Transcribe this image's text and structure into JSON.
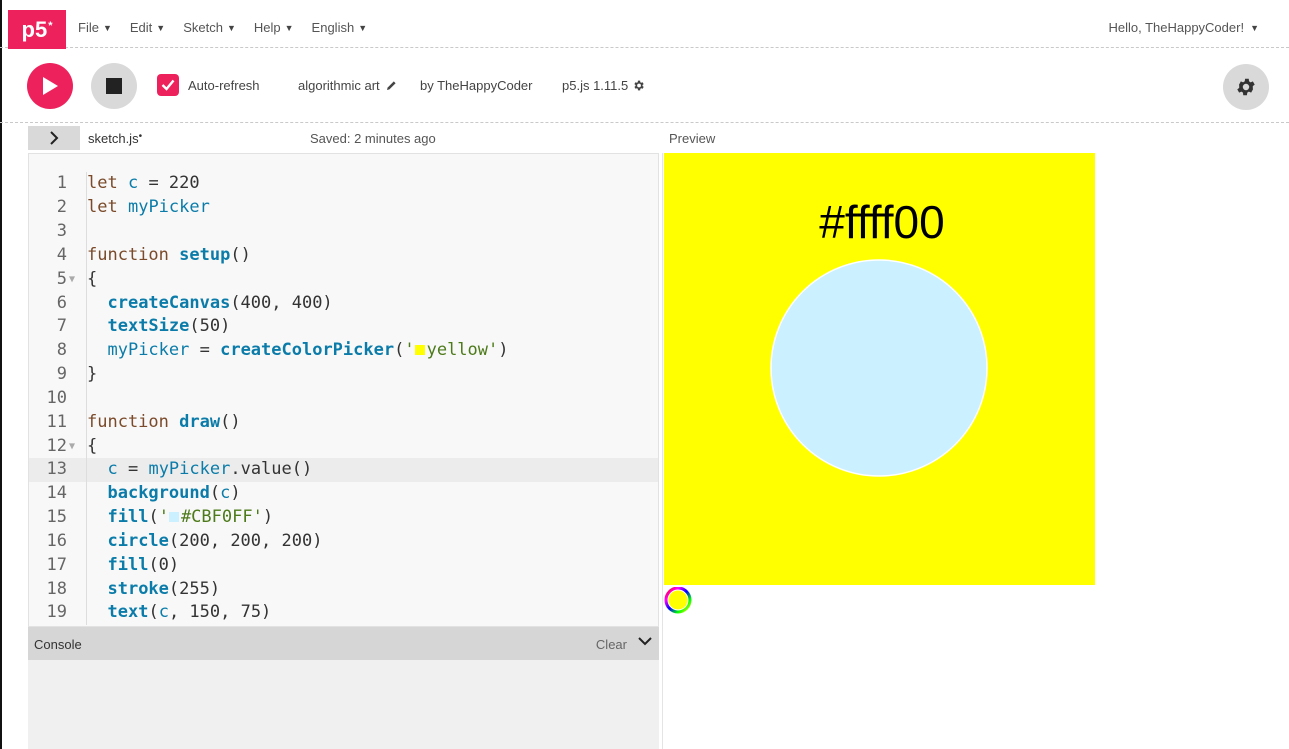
{
  "nav": {
    "logo": "p5",
    "logo_sup": "*",
    "menu": [
      {
        "label": "File"
      },
      {
        "label": "Edit"
      },
      {
        "label": "Sketch"
      },
      {
        "label": "Help"
      },
      {
        "label": "English"
      }
    ],
    "user_greeting": "Hello, TheHappyCoder!"
  },
  "toolbar": {
    "auto_refresh_label": "Auto-refresh",
    "auto_refresh_checked": true,
    "sketch_name": "algorithmic art",
    "owner": "by TheHappyCoder",
    "version": "p5.js 1.11.5"
  },
  "editor": {
    "file_name": "sketch.js",
    "unsaved_dot": "•",
    "saved_status": "Saved: 2 minutes ago",
    "active_line": 13,
    "line_numbers": [
      "1",
      "2",
      "3",
      "4",
      "5",
      "6",
      "7",
      "8",
      "9",
      "10",
      "11",
      "12",
      "13",
      "14",
      "15",
      "16",
      "17",
      "18",
      "19"
    ]
  },
  "console": {
    "title": "Console",
    "clear_label": "Clear"
  },
  "preview": {
    "label": "Preview",
    "canvas_text": "#ffff00",
    "background_color": "#ffff00",
    "circle_color": "#CBF0FF"
  },
  "colors": {
    "accent": "#ed225d"
  }
}
